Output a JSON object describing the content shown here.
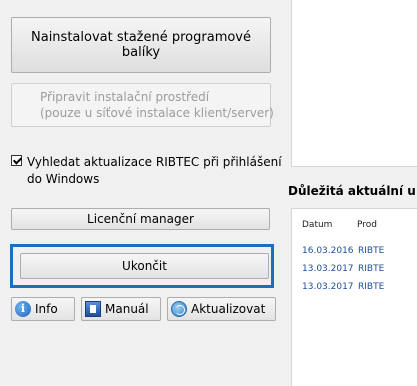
{
  "buttons": {
    "install": "Nainstalovat stažené programové balíky",
    "prepare_line1": "Připravit instalační prostředí",
    "prepare_line2": "(pouze u síťové instalace klient/server)",
    "license": "Licenční manager",
    "exit": "Ukončit",
    "info": "Info",
    "manual": "Manuál",
    "update": "Aktualizovat"
  },
  "checkbox": {
    "checked": true,
    "label_line1": "Vyhledat aktualizace RIBTEC při přihlášení",
    "label_line2": "do Windows"
  },
  "news": {
    "title": "Důležitá aktuální u",
    "columns": [
      "Datum",
      "Prod"
    ],
    "rows": [
      {
        "date": "16.03.2016",
        "product": "RIBTE"
      },
      {
        "date": "13.03.2017",
        "product": "RIBTE"
      },
      {
        "date": "13.03.2017",
        "product": "RIBTE"
      }
    ]
  },
  "colors": {
    "highlight_border": "#1c6fc0",
    "link_text": "#1f4e9a"
  }
}
